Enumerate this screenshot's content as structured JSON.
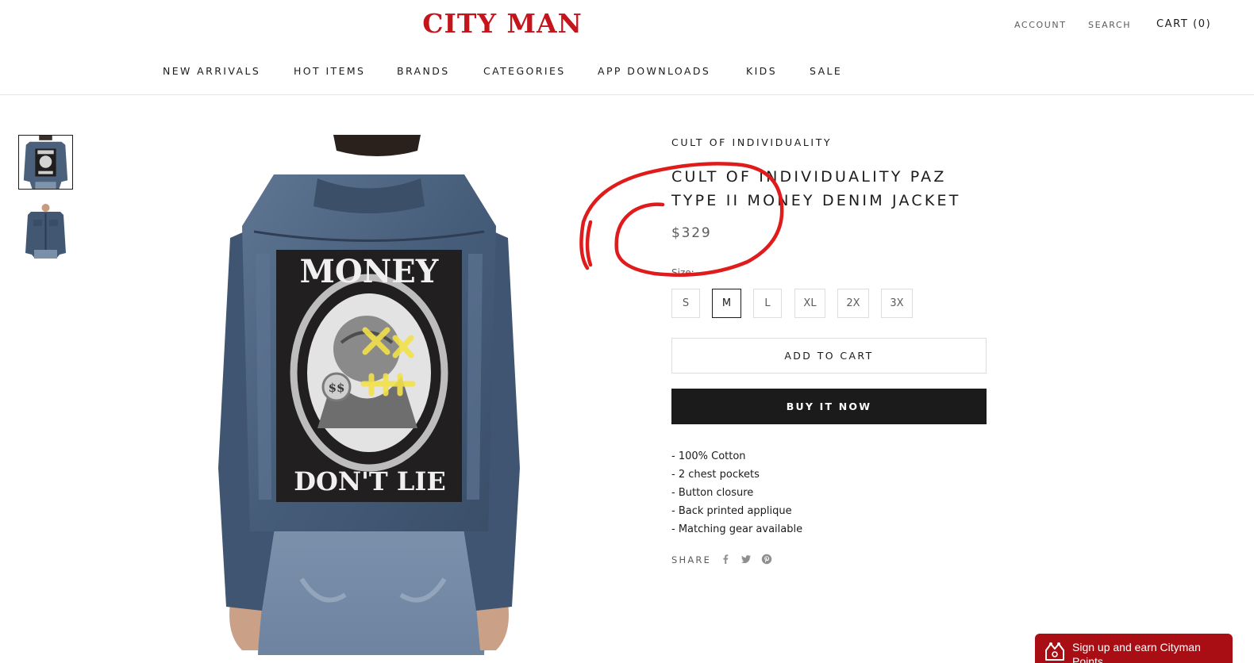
{
  "header": {
    "logo": "CITY MAN",
    "account": "ACCOUNT",
    "search": "SEARCH",
    "cart": "CART (0)"
  },
  "nav": {
    "items": [
      "NEW ARRIVALS",
      "HOT ITEMS",
      "BRANDS",
      "CATEGORIES",
      "APP DOWNLOADS",
      "KIDS",
      "SALE"
    ]
  },
  "product": {
    "vendor": "CULT OF INDIVIDUALITY",
    "title": "CULT OF INDIVIDUALITY PAZ TYPE II MONEY DENIM JACKET",
    "price": "$329",
    "size_label": "Size:",
    "sizes": [
      "S",
      "M",
      "L",
      "XL",
      "2X",
      "3X"
    ],
    "selected_size": "M",
    "add_to_cart": "ADD TO CART",
    "buy_now": "BUY IT NOW",
    "description": [
      "- 100% Cotton",
      "- 2 chest pockets",
      "- Button closure",
      "- Back printed applique",
      "- Matching gear available"
    ],
    "image_text": {
      "top": "MONEY",
      "bottom": "DON'T LIE",
      "coin": "$$"
    }
  },
  "share": {
    "label": "SHARE",
    "icons": [
      "facebook-icon",
      "twitter-icon",
      "pinterest-icon"
    ]
  },
  "rewards": {
    "text": "Sign up and earn Cityman Points"
  },
  "colors": {
    "brand_red": "#c4141c",
    "text": "#1c1b1b",
    "muted": "#5c5c5c",
    "button_dark": "#1c1b1b",
    "rewards_bg": "#a90e14",
    "annotation": "#e01b1b"
  }
}
